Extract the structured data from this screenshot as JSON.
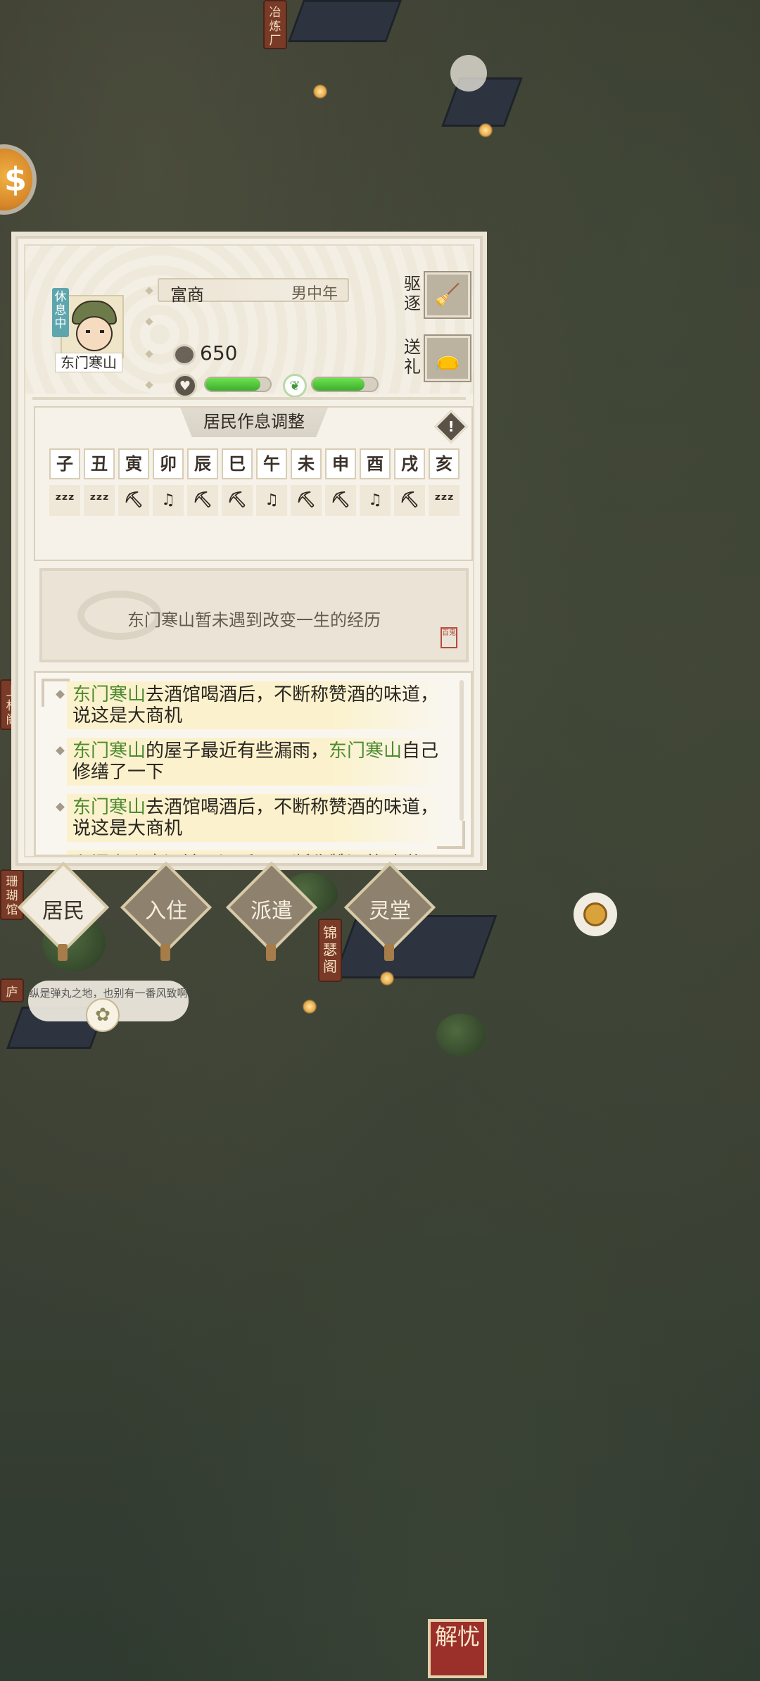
{
  "scene": {
    "signs": [
      "冶炼厂",
      "上林阁",
      "珊瑚馆",
      "锦瑟阁",
      "庐"
    ],
    "thought_bubble": "纵是弹丸之地，也别有一番风致啊",
    "jieyou_label": "解忧"
  },
  "resident": {
    "status_tag": "休息中",
    "name": "东门寒山",
    "occupation": "富商",
    "gender_age": "男中年",
    "money": "650",
    "health_fraction": 0.85,
    "mood_fraction": 0.8
  },
  "actions": {
    "expel_label": "驱逐",
    "gift_label": "送礼"
  },
  "schedule": {
    "title": "居民作息调整",
    "hours": [
      "子",
      "丑",
      "寅",
      "卯",
      "辰",
      "巳",
      "午",
      "未",
      "申",
      "酉",
      "戌",
      "亥"
    ],
    "activities": [
      "sleep-icon",
      "sleep-icon",
      "work-pickaxe-icon",
      "leisure-music-icon",
      "work-pickaxe-icon",
      "work-pickaxe-icon",
      "leisure-music-icon",
      "work-pickaxe-icon",
      "work-pickaxe-icon",
      "leisure-music-icon",
      "work-pickaxe-icon",
      "sleep-icon"
    ]
  },
  "story": {
    "text": "东门寒山暂未遇到改变一生的经历",
    "seal": "百鬼"
  },
  "log": [
    {
      "parts": [
        {
          "t": "东门寒山",
          "hl": true
        },
        {
          "t": "去酒馆喝酒后，不断称赞酒的味道，说这是大商机",
          "hl": false
        }
      ]
    },
    {
      "parts": [
        {
          "t": "东门寒山",
          "hl": true
        },
        {
          "t": "的屋子最近有些漏雨，",
          "hl": false
        },
        {
          "t": "东门寒山",
          "hl": true
        },
        {
          "t": "自己修缮了一下",
          "hl": false
        }
      ]
    },
    {
      "parts": [
        {
          "t": "东门寒山",
          "hl": true
        },
        {
          "t": "去酒馆喝酒后，不断称赞酒的味道，说这是大商机",
          "hl": false
        }
      ]
    },
    {
      "parts": [
        {
          "t": "东门寒山",
          "hl": true
        },
        {
          "t": "去酒馆喝酒后，不断称赞酒的味道，说",
          "hl": false
        }
      ]
    }
  ],
  "nav": [
    {
      "label": "居民",
      "active": true
    },
    {
      "label": "入住",
      "active": false
    },
    {
      "label": "派遣",
      "active": false
    },
    {
      "label": "灵堂",
      "active": false
    }
  ],
  "colors": {
    "highlight_name": "#4e8a2f",
    "bar_fill": "#4cc43a",
    "panel_bg": "#f4f0e6"
  }
}
